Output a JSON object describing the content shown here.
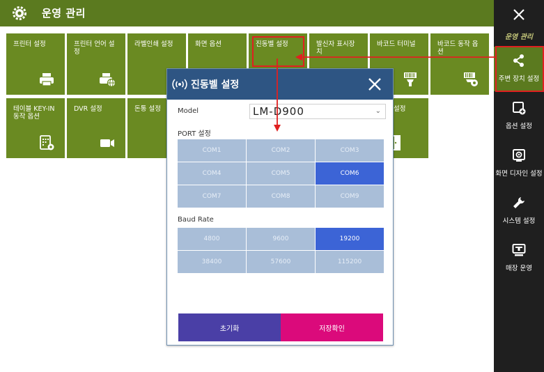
{
  "header": {
    "title": "운영 관리",
    "icon": "gear-icon"
  },
  "tiles": [
    {
      "label": "프린터 설정",
      "icon": "printer-icon"
    },
    {
      "label": "프린터 언어 설\n정",
      "icon": "printer-globe-icon"
    },
    {
      "label": "라벨인쇄 설정",
      "icon": ""
    },
    {
      "label": "화면 옵션",
      "icon": ""
    },
    {
      "label": "진동벨 설정",
      "icon": ""
    },
    {
      "label": "발신자 표시장\n치",
      "icon": ""
    },
    {
      "label": "바코드 터미널",
      "icon": "barcode-scanner-icon"
    },
    {
      "label": "바코드 동작 옵\n션",
      "icon": "barcode-settings-icon"
    },
    {
      "label": "테이블 KEY-IN\n동작 옵션",
      "icon": "keypad-settings-icon"
    },
    {
      "label": "DVR 설정",
      "icon": "camera-icon"
    },
    {
      "label": "돈통 설정",
      "icon": ""
    },
    {
      "label": "설정",
      "icon": "door-icon"
    }
  ],
  "sidebar": {
    "close_icon": "close-icon",
    "section_title": "운영 관리",
    "items": [
      {
        "label": "주변 장치 설정",
        "icon": "share-icon",
        "active": true
      },
      {
        "label": "옵션 설정",
        "icon": "window-plus-icon",
        "active": false
      },
      {
        "label": "화면 디자인 설정",
        "icon": "screen-design-icon",
        "active": false
      },
      {
        "label": "시스템 설정",
        "icon": "wrench-icon",
        "active": false
      },
      {
        "label": "매장 운영",
        "icon": "pos-terminal-icon",
        "active": false
      }
    ]
  },
  "dialog": {
    "title": "진동벨 설정",
    "title_icon": "wireless-icon",
    "model_label": "Model",
    "model_value": "LM-D900",
    "port_label": "PORT 설정",
    "ports": [
      "COM1",
      "COM2",
      "COM3",
      "COM4",
      "COM5",
      "COM6",
      "COM7",
      "COM8",
      "COM9"
    ],
    "selected_port": "COM6",
    "baud_label": "Baud Rate",
    "bauds": [
      "4800",
      "9600",
      "19200",
      "38400",
      "57600",
      "115200"
    ],
    "selected_baud": "19200",
    "reset_label": "초기화",
    "save_label": "저장확인"
  },
  "colors": {
    "header": "#5b7a1f",
    "tile": "#6a8a22",
    "sidebar": "#1f1f1f",
    "dialog_header": "#2e5583",
    "option": "#a9bed8",
    "option_selected": "#3c64d6",
    "reset_button": "#4a3fa6",
    "save_button": "#db0a7b",
    "annotation": "#e02020"
  }
}
